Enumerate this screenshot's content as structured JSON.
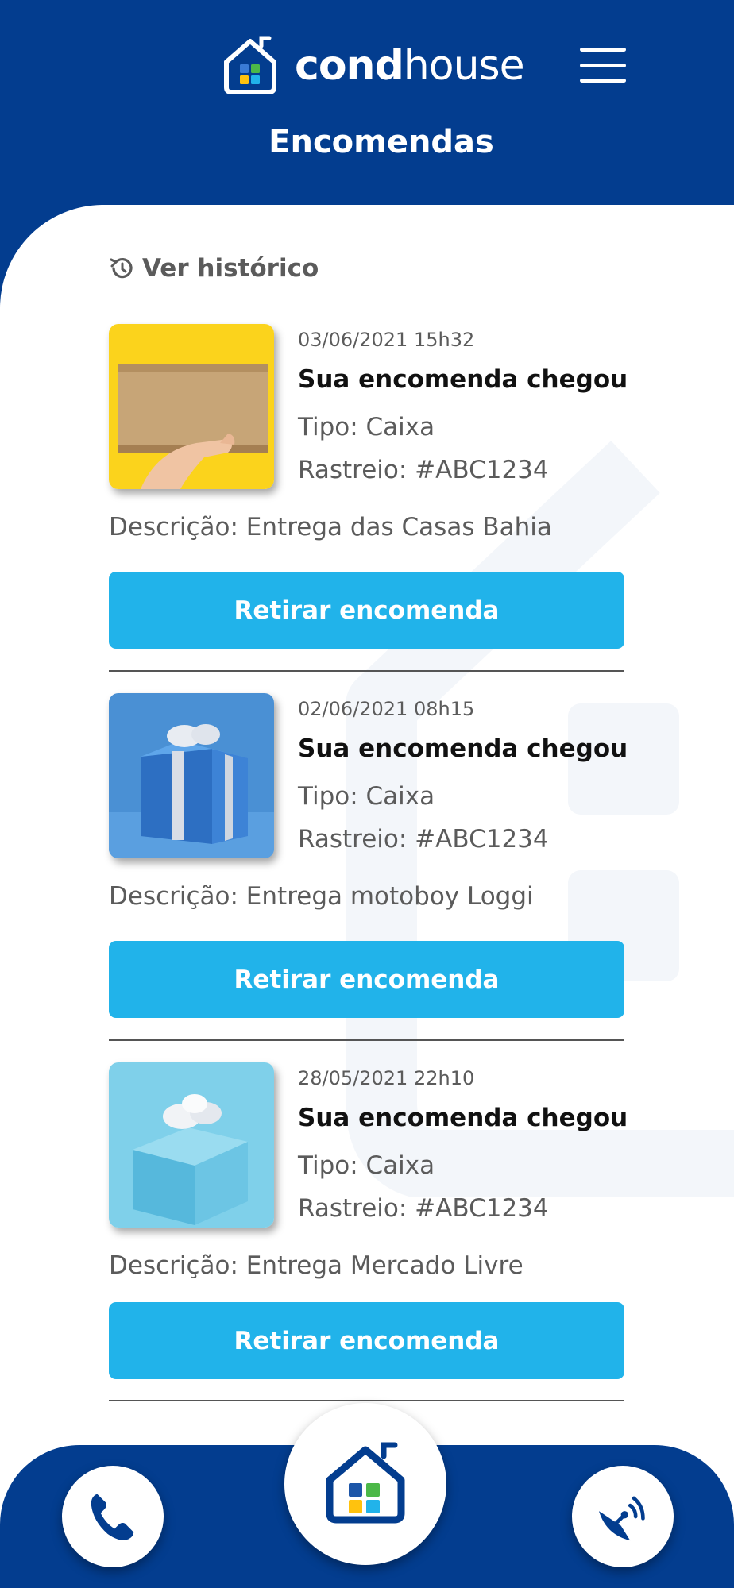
{
  "app": {
    "brand_bold": "cond",
    "brand_regular": "house",
    "page_title": "Encomendas",
    "menu_icon": "hamburger-menu-icon"
  },
  "history_link": {
    "label": "Ver histórico",
    "icon": "history-icon"
  },
  "packages": [
    {
      "date": "03/06/2021 15h32",
      "title": "Sua encomenda chegou",
      "tipo": "Tipo: Caixa",
      "rastreio": "Rastreio: #ABC1234",
      "descricao": "Descrição: Entrega das Casas Bahia",
      "button": "Retirar encomenda",
      "image": "cardboard-box-photo"
    },
    {
      "date": "02/06/2021 08h15",
      "title": "Sua encomenda chegou",
      "tipo": "Tipo: Caixa",
      "rastreio": "Rastreio: #ABC1234",
      "descricao": "Descrição: Entrega motoboy Loggi",
      "button": "Retirar encomenda",
      "image": "blue-gift-box-photo"
    },
    {
      "date": "28/05/2021 22h10",
      "title": "Sua encomenda chegou",
      "tipo": "Tipo: Caixa",
      "rastreio": "Rastreio: #ABC1234",
      "descricao": "Descrição: Entrega Mercado Livre",
      "button": "Retirar encomenda",
      "image": "light-blue-gift-photo"
    }
  ],
  "bottom_nav": {
    "left_icon": "phone-icon",
    "center_icon": "condhouse-home-icon",
    "right_icon": "satellite-dish-icon"
  },
  "colors": {
    "primary": "#033d8f",
    "accent": "#21b3ea",
    "text_muted": "#5b5b5b"
  }
}
